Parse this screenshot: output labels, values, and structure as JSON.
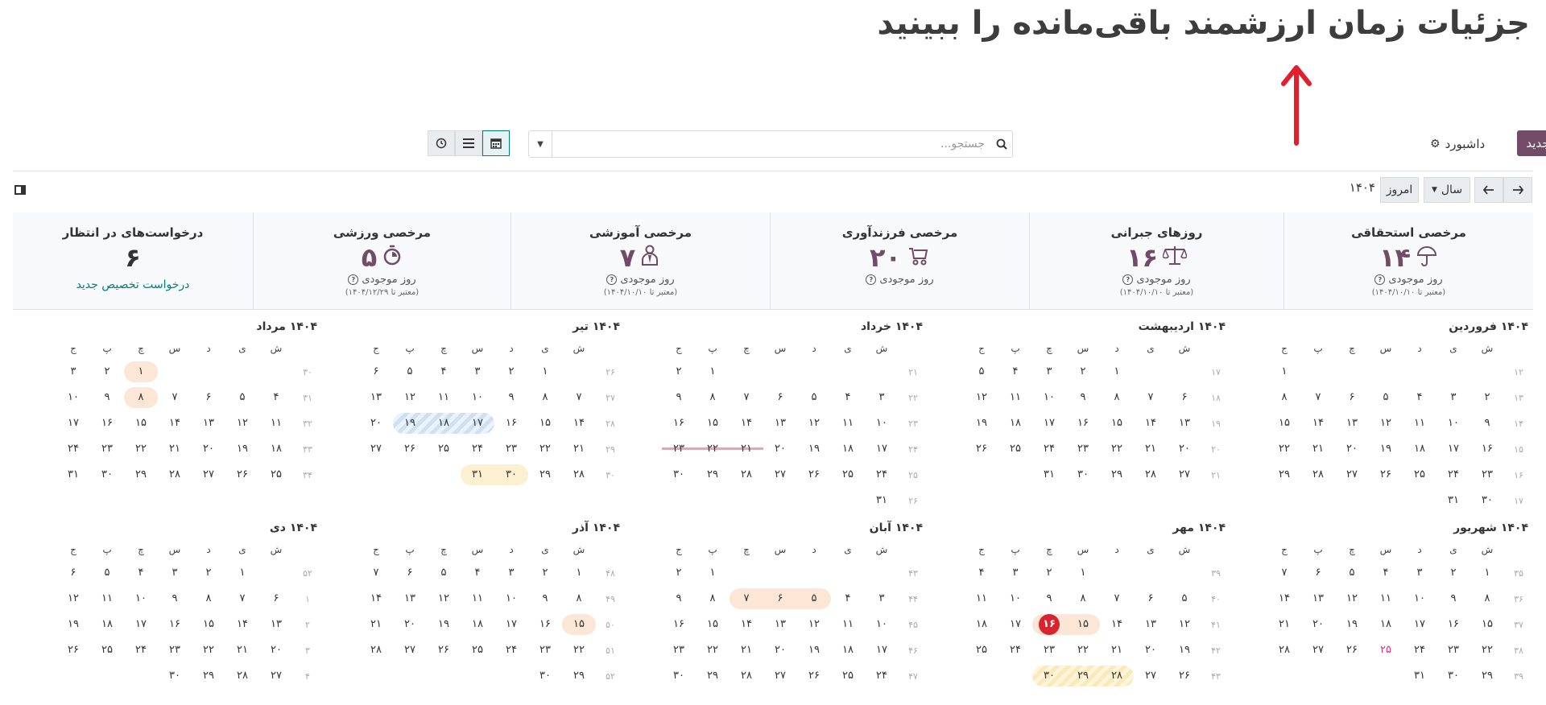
{
  "caption": "جزئیات زمان ارزشمند باقی‌مانده را ببینید",
  "toolbar": {
    "new_label": "جدید",
    "dashboard_label": "داشبورد",
    "search_placeholder": "جستجو..."
  },
  "nav": {
    "today_label": "امروز",
    "scale_label": "سال",
    "year_title": "۱۴۰۴"
  },
  "cards": [
    {
      "title": "مرخصی استحقاقی",
      "value": "۱۴",
      "sub": "روز موجودی",
      "valid": "(معتبر تا ۱۴۰۴/۱۰/۱۰)",
      "icon": "umbrella-icon"
    },
    {
      "title": "روزهای جبرانی",
      "value": "۱۶",
      "sub": "روز موجودی",
      "valid": "(معتبر تا ۱۴۰۴/۱۰/۱۰)",
      "icon": "scale-icon"
    },
    {
      "title": "مرخصی فرزندآوری",
      "value": "۲۰",
      "sub": "روز موجودی",
      "valid": "",
      "icon": "stroller-icon"
    },
    {
      "title": "مرخصی آموزشی",
      "value": "۷",
      "sub": "روز موجودی",
      "valid": "(معتبر تا ۱۴۰۴/۱۰/۱۰)",
      "icon": "teacher-icon"
    },
    {
      "title": "مرخصی ورزشی",
      "value": "۵",
      "sub": "روز موجودی",
      "valid": "(معتبر تا ۱۴۰۴/۱۲/۲۹)",
      "icon": "stopwatch-icon"
    },
    {
      "title": "درخواست‌های در انتظار",
      "value": "۶",
      "link": "درخواست تخصیص جدید"
    }
  ],
  "weekday_headers": [
    "ش",
    "ی",
    "د",
    "س",
    "چ",
    "پ",
    "ج"
  ],
  "months": [
    {
      "name": "۱۴۰۴ فروردین",
      "weeks": [
        [
          "۱۲",
          "",
          "",
          "",
          "",
          "",
          "",
          "۱"
        ],
        [
          "۱۳",
          "۲",
          "۳",
          "۴",
          "۵",
          "۶",
          "۷",
          "۸"
        ],
        [
          "۱۴",
          "۹",
          "۱۰",
          "۱۱",
          "۱۲",
          "۱۳",
          "۱۴",
          "۱۵"
        ],
        [
          "۱۵",
          "۱۶",
          "۱۷",
          "۱۸",
          "۱۹",
          "۲۰",
          "۲۱",
          "۲۲"
        ],
        [
          "۱۶",
          "۲۳",
          "۲۴",
          "۲۵",
          "۲۶",
          "۲۷",
          "۲۸",
          "۲۹"
        ],
        [
          "۱۷",
          "۳۰",
          "۳۱",
          "",
          "",
          "",
          "",
          ""
        ]
      ]
    },
    {
      "name": "۱۴۰۴ اردیبهشت",
      "weeks": [
        [
          "۱۷",
          "",
          "",
          "۱",
          "۲",
          "۳",
          "۴",
          "۵"
        ],
        [
          "۱۸",
          "۶",
          "۷",
          "۸",
          "۹",
          "۱۰",
          "۱۱",
          "۱۲"
        ],
        [
          "۱۹",
          "۱۳",
          "۱۴",
          "۱۵",
          "۱۶",
          "۱۷",
          "۱۸",
          "۱۹"
        ],
        [
          "۲۰",
          "۲۰",
          "۲۱",
          "۲۲",
          "۲۳",
          "۲۴",
          "۲۵",
          "۲۶"
        ],
        [
          "۲۱",
          "۲۷",
          "۲۸",
          "۲۹",
          "۳۰",
          "۳۱",
          "",
          ""
        ]
      ]
    },
    {
      "name": "۱۴۰۴ خرداد",
      "weeks": [
        [
          "۲۱",
          "",
          "",
          "",
          "",
          "",
          "۱",
          "۲"
        ],
        [
          "۲۲",
          "۳",
          "۴",
          "۵",
          "۶",
          "۷",
          "۸",
          "۹"
        ],
        [
          "۲۳",
          "۱۰",
          "۱۱",
          "۱۲",
          "۱۳",
          "۱۴",
          "۱۵",
          "۱۶"
        ],
        [
          "۲۴",
          "۱۷",
          "۱۸",
          "۱۹",
          "۲۰",
          "۲۱",
          "۲۲",
          "۲۳"
        ],
        [
          "۲۵",
          "۲۴",
          "۲۵",
          "۲۶",
          "۲۷",
          "۲۸",
          "۲۹",
          "۳۰"
        ],
        [
          "۲۶",
          "۳۱",
          "",
          "",
          "",
          "",
          "",
          ""
        ]
      ]
    },
    {
      "name": "۱۴۰۴ تیر",
      "weeks": [
        [
          "۲۶",
          "",
          "۱",
          "۲",
          "۳",
          "۴",
          "۵",
          "۶"
        ],
        [
          "۲۷",
          "۷",
          "۸",
          "۹",
          "۱۰",
          "۱۱",
          "۱۲",
          "۱۳"
        ],
        [
          "۲۸",
          "۱۴",
          "۱۵",
          "۱۶",
          "۱۷",
          "۱۸",
          "۱۹",
          "۲۰"
        ],
        [
          "۲۹",
          "۲۱",
          "۲۲",
          "۲۳",
          "۲۴",
          "۲۵",
          "۲۶",
          "۲۷"
        ],
        [
          "۳۰",
          "۲۸",
          "۲۹",
          "۳۰",
          "۳۱",
          "",
          "",
          ""
        ]
      ]
    },
    {
      "name": "۱۴۰۴ مرداد",
      "weeks": [
        [
          "۳۰",
          "",
          "",
          "",
          "",
          "۱",
          "۲",
          "۳"
        ],
        [
          "۳۱",
          "۴",
          "۵",
          "۶",
          "۷",
          "۸",
          "۹",
          "۱۰"
        ],
        [
          "۳۲",
          "۱۱",
          "۱۲",
          "۱۳",
          "۱۴",
          "۱۵",
          "۱۶",
          "۱۷"
        ],
        [
          "۳۳",
          "۱۸",
          "۱۹",
          "۲۰",
          "۲۱",
          "۲۲",
          "۲۳",
          "۲۴"
        ],
        [
          "۳۴",
          "۲۵",
          "۲۶",
          "۲۷",
          "۲۸",
          "۲۹",
          "۳۰",
          "۳۱"
        ]
      ]
    },
    {
      "name": "۱۴۰۴ شهریور",
      "weeks": [
        [
          "۳۵",
          "۱",
          "۲",
          "۳",
          "۴",
          "۵",
          "۶",
          "۷"
        ],
        [
          "۳۶",
          "۸",
          "۹",
          "۱۰",
          "۱۱",
          "۱۲",
          "۱۳",
          "۱۴"
        ],
        [
          "۳۷",
          "۱۵",
          "۱۶",
          "۱۷",
          "۱۸",
          "۱۹",
          "۲۰",
          "۲۱"
        ],
        [
          "۳۸",
          "۲۲",
          "۲۳",
          "۲۴",
          "۲۵",
          "۲۶",
          "۲۷",
          "۲۸"
        ],
        [
          "۳۹",
          "۲۹",
          "۳۰",
          "۳۱",
          "",
          "",
          "",
          ""
        ]
      ]
    },
    {
      "name": "۱۴۰۴ مهر",
      "weeks": [
        [
          "۳۹",
          "",
          "",
          "",
          "۱",
          "۲",
          "۳",
          "۴"
        ],
        [
          "۴۰",
          "۵",
          "۶",
          "۷",
          "۸",
          "۹",
          "۱۰",
          "۱۱"
        ],
        [
          "۴۱",
          "۱۲",
          "۱۳",
          "۱۴",
          "۱۵",
          "۱۶",
          "۱۷",
          "۱۸"
        ],
        [
          "۴۲",
          "۱۹",
          "۲۰",
          "۲۱",
          "۲۲",
          "۲۳",
          "۲۴",
          "۲۵"
        ],
        [
          "۴۳",
          "۲۶",
          "۲۷",
          "۲۸",
          "۲۹",
          "۳۰",
          "",
          ""
        ]
      ]
    },
    {
      "name": "۱۴۰۴ آبان",
      "weeks": [
        [
          "۴۳",
          "",
          "",
          "",
          "",
          "",
          "۱",
          "۲"
        ],
        [
          "۴۴",
          "۳",
          "۴",
          "۵",
          "۶",
          "۷",
          "۸",
          "۹"
        ],
        [
          "۴۵",
          "۱۰",
          "۱۱",
          "۱۲",
          "۱۳",
          "۱۴",
          "۱۵",
          "۱۶"
        ],
        [
          "۴۶",
          "۱۷",
          "۱۸",
          "۱۹",
          "۲۰",
          "۲۱",
          "۲۲",
          "۲۳"
        ],
        [
          "۴۷",
          "۲۴",
          "۲۵",
          "۲۶",
          "۲۷",
          "۲۸",
          "۲۹",
          "۳۰"
        ]
      ]
    },
    {
      "name": "۱۴۰۴ آذر",
      "weeks": [
        [
          "۴۸",
          "۱",
          "۲",
          "۳",
          "۴",
          "۵",
          "۶",
          "۷"
        ],
        [
          "۴۹",
          "۸",
          "۹",
          "۱۰",
          "۱۱",
          "۱۲",
          "۱۳",
          "۱۴"
        ],
        [
          "۵۰",
          "۱۵",
          "۱۶",
          "۱۷",
          "۱۸",
          "۱۹",
          "۲۰",
          "۲۱"
        ],
        [
          "۵۱",
          "۲۲",
          "۲۳",
          "۲۴",
          "۲۵",
          "۲۶",
          "۲۷",
          "۲۸"
        ],
        [
          "۵۲",
          "۲۹",
          "۳۰",
          "",
          "",
          "",
          "",
          ""
        ]
      ]
    },
    {
      "name": "۱۴۰۴ دی",
      "weeks": [
        [
          "۵۲",
          "",
          "۱",
          "۲",
          "۳",
          "۴",
          "۵",
          "۶"
        ],
        [
          "۱",
          "۶",
          "۷",
          "۸",
          "۹",
          "۱۰",
          "۱۱",
          "۱۲"
        ],
        [
          "۲",
          "۱۳",
          "۱۴",
          "۱۵",
          "۱۶",
          "۱۷",
          "۱۸",
          "۱۹"
        ],
        [
          "۳",
          "۲۰",
          "۲۱",
          "۲۲",
          "۲۳",
          "۲۴",
          "۲۵",
          "۲۶"
        ],
        [
          "۴",
          "۲۷",
          "۲۸",
          "۲۹",
          "۳۰",
          "",
          "",
          ""
        ]
      ]
    }
  ],
  "highlights": {
    "holiday_color": "#d63384",
    "today_color": "#d9232d",
    "accent": "#714b67",
    "link_color": "#017e84"
  }
}
